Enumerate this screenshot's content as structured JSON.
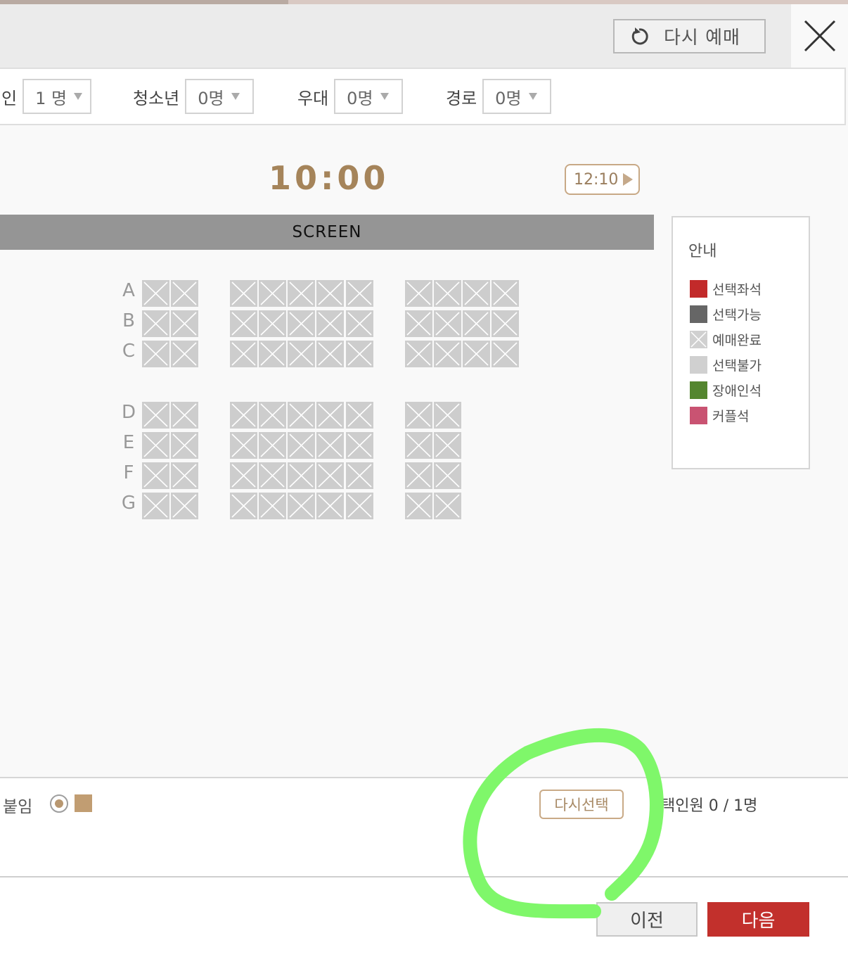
{
  "header": {
    "rebook_label": "다시 예매"
  },
  "people": [
    {
      "label": "인",
      "value": "1 명"
    },
    {
      "label": "청소년",
      "value": "0명"
    },
    {
      "label": "우대",
      "value": "0명"
    },
    {
      "label": "경로",
      "value": "0명"
    }
  ],
  "showtime": {
    "current": "10:00",
    "next": "12:10"
  },
  "screen_label": "SCREEN",
  "seat_map": {
    "rows": [
      "A",
      "B",
      "C",
      "D",
      "E",
      "F",
      "G"
    ],
    "status": "예매완료"
  },
  "legend": {
    "title": "안내",
    "items": [
      {
        "label": "선택좌석",
        "color": "#c22a2a"
      },
      {
        "label": "선택가능",
        "color": "#666666"
      },
      {
        "label": "예매완료",
        "color": "#d0d0d0"
      },
      {
        "label": "선택불가",
        "color": "#d0d0d0"
      },
      {
        "label": "장애인석",
        "color": "#54862f"
      },
      {
        "label": "커플석",
        "color": "#c95372"
      }
    ]
  },
  "bottom": {
    "attach_label": "붙임",
    "reselect_label": "다시선택",
    "selected_count": "택인원 0 / 1명"
  },
  "nav": {
    "prev_label": "이전",
    "next_label": "다음"
  },
  "colors": {
    "accent_gold": "#a5845a",
    "next_red": "#c2302c",
    "annotation_green": "#7ff76a"
  }
}
